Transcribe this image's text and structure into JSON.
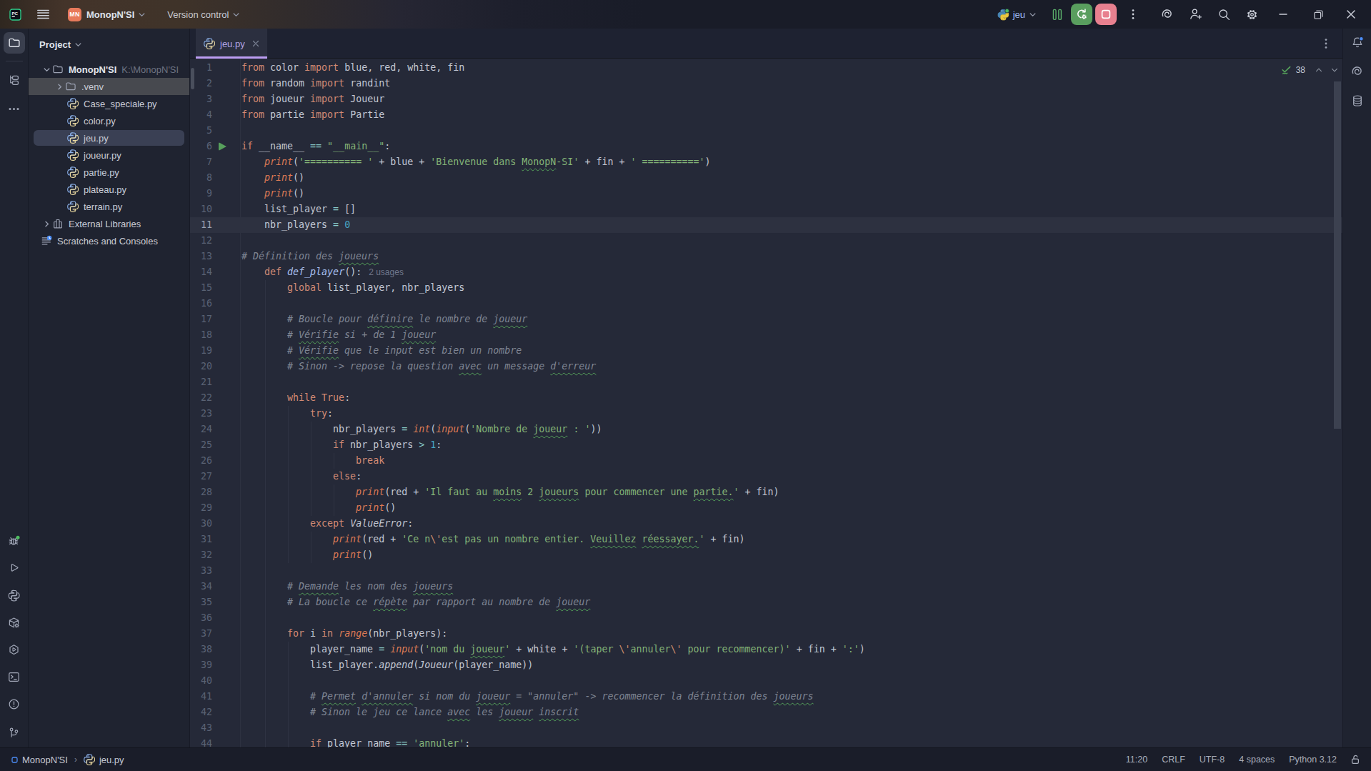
{
  "titlebar": {
    "app": "PyCharm",
    "project_avatar": "MN",
    "project_name": "MonopN'SI",
    "vcs_label": "Version control",
    "run_config": "jeu",
    "accent_green": "#599e5e",
    "accent_red": "#e8808f"
  },
  "tabs": [
    {
      "label": "jeu.py",
      "icon": "python-file",
      "active": true
    }
  ],
  "left_stripe": {
    "top": [
      {
        "name": "project",
        "icon": "folder",
        "selected": true
      },
      {
        "name": "structure",
        "icon": "structure"
      },
      {
        "name": "more-tool-windows",
        "icon": "more-dots"
      }
    ],
    "bottom": [
      {
        "name": "debug",
        "icon": "bug",
        "badge": "green"
      },
      {
        "name": "run",
        "icon": "play"
      },
      {
        "name": "python-console",
        "icon": "python-outline"
      },
      {
        "name": "python-packages",
        "icon": "packages"
      },
      {
        "name": "services",
        "icon": "services"
      },
      {
        "name": "terminal",
        "icon": "terminal"
      },
      {
        "name": "problems",
        "icon": "problems"
      },
      {
        "name": "version-control",
        "icon": "git-branch"
      }
    ]
  },
  "right_stripe": [
    {
      "name": "ai-assistant",
      "icon": "ai-swirl"
    },
    {
      "name": "database",
      "icon": "database"
    }
  ],
  "project_panel": {
    "header": "Project",
    "tree": [
      {
        "label": "MonopN'SI",
        "path": "K:\\MonopN'SI",
        "icon": "folder",
        "chevron": "down",
        "level": 0,
        "bold": true
      },
      {
        "label": ".venv",
        "icon": "folder",
        "chevron": "right",
        "level": 1,
        "hover": true
      },
      {
        "label": "Case_speciale.py",
        "icon": "python-file",
        "level": 2
      },
      {
        "label": "color.py",
        "icon": "python-file",
        "level": 2
      },
      {
        "label": "jeu.py",
        "icon": "python-file",
        "level": 2,
        "selected": true
      },
      {
        "label": "joueur.py",
        "icon": "python-file",
        "level": 2
      },
      {
        "label": "partie.py",
        "icon": "python-file",
        "level": 2
      },
      {
        "label": "plateau.py",
        "icon": "python-file",
        "level": 2
      },
      {
        "label": "terrain.py",
        "icon": "python-file",
        "level": 2
      },
      {
        "label": "External Libraries",
        "icon": "library",
        "chevron": "right",
        "level": 0
      },
      {
        "label": "Scratches and Consoles",
        "icon": "scratches",
        "level": 0
      }
    ]
  },
  "editor": {
    "inspection_count": "38",
    "lines": [
      {
        "n": 1,
        "t": [
          [
            "k",
            "from"
          ],
          [
            "d",
            " color "
          ],
          [
            "k",
            "import"
          ],
          [
            "d",
            " blue, red, white, fin"
          ]
        ]
      },
      {
        "n": 2,
        "t": [
          [
            "k",
            "from"
          ],
          [
            "d",
            " random "
          ],
          [
            "k",
            "import"
          ],
          [
            "d",
            " randint"
          ]
        ]
      },
      {
        "n": 3,
        "t": [
          [
            "k",
            "from"
          ],
          [
            "d",
            " joueur "
          ],
          [
            "k",
            "import"
          ],
          [
            "d",
            " Joueur"
          ]
        ]
      },
      {
        "n": 4,
        "t": [
          [
            "k",
            "from"
          ],
          [
            "d",
            " partie "
          ],
          [
            "k",
            "import"
          ],
          [
            "d",
            " Partie"
          ]
        ]
      },
      {
        "n": 5,
        "t": []
      },
      {
        "n": 6,
        "t": [
          [
            "k",
            "if"
          ],
          [
            "d",
            " __name__ "
          ],
          [
            "o",
            "=="
          ],
          [
            "d",
            " "
          ],
          [
            "s",
            "\"__main__\""
          ],
          [
            "d",
            ":"
          ]
        ],
        "run": true
      },
      {
        "n": 7,
        "t": [
          [
            "d",
            "    "
          ],
          [
            "b",
            "print"
          ],
          [
            "d",
            "("
          ],
          [
            "s",
            "'========== '"
          ],
          [
            "d",
            " + blue + "
          ],
          [
            "s",
            "'Bienvenue dans "
          ],
          [
            "q",
            "MonopN"
          ],
          [
            "s",
            "-SI'"
          ],
          [
            "d",
            " + fin + "
          ],
          [
            "s",
            "' =========='"
          ],
          [
            "d",
            ")"
          ]
        ]
      },
      {
        "n": 8,
        "t": [
          [
            "d",
            "    "
          ],
          [
            "b",
            "print"
          ],
          [
            "d",
            "()"
          ]
        ]
      },
      {
        "n": 9,
        "t": [
          [
            "d",
            "    "
          ],
          [
            "b",
            "print"
          ],
          [
            "d",
            "()"
          ]
        ]
      },
      {
        "n": 10,
        "t": [
          [
            "d",
            "    list_player "
          ],
          [
            "o",
            "="
          ],
          [
            "d",
            " []"
          ]
        ]
      },
      {
        "n": 11,
        "t": [
          [
            "d",
            "    nbr_players "
          ],
          [
            "o",
            "="
          ],
          [
            "d",
            " "
          ],
          [
            "n",
            "0"
          ]
        ],
        "caret": true
      },
      {
        "n": 12,
        "t": []
      },
      {
        "n": 13,
        "t": [
          [
            "c",
            "# Définition des "
          ],
          [
            "m",
            "joueurs"
          ]
        ]
      },
      {
        "n": 14,
        "t": [
          [
            "d",
            "    "
          ],
          [
            "k",
            "def"
          ],
          [
            "d",
            " "
          ],
          [
            "f",
            "def_player"
          ],
          [
            "d",
            "():"
          ],
          [
            "h",
            "2 usages"
          ]
        ]
      },
      {
        "n": 15,
        "t": [
          [
            "d",
            "        "
          ],
          [
            "k",
            "global"
          ],
          [
            "d",
            " list_player, nbr_players"
          ]
        ],
        "g": [
          4
        ]
      },
      {
        "n": 16,
        "t": [],
        "g": [
          4
        ]
      },
      {
        "n": 17,
        "t": [
          [
            "c",
            "        # Boucle pour "
          ],
          [
            "m",
            "définire"
          ],
          [
            "c",
            " le nombre de "
          ],
          [
            "m",
            "joueur"
          ]
        ],
        "g": [
          4
        ]
      },
      {
        "n": 18,
        "t": [
          [
            "c",
            "        # "
          ],
          [
            "m",
            "Vérifie"
          ],
          [
            "c",
            " si + de 1 "
          ],
          [
            "m",
            "joueur"
          ]
        ],
        "g": [
          4
        ]
      },
      {
        "n": 19,
        "t": [
          [
            "c",
            "        # "
          ],
          [
            "m",
            "Vérifie"
          ],
          [
            "c",
            " que le input est bien un nombre"
          ]
        ],
        "g": [
          4
        ]
      },
      {
        "n": 20,
        "t": [
          [
            "c",
            "        # Sinon -> repose la question "
          ],
          [
            "m",
            "avec"
          ],
          [
            "c",
            " un message "
          ],
          [
            "m",
            "d'erreur"
          ]
        ],
        "g": [
          4
        ]
      },
      {
        "n": 21,
        "t": [],
        "g": [
          4
        ]
      },
      {
        "n": 22,
        "t": [
          [
            "d",
            "        "
          ],
          [
            "k",
            "while"
          ],
          [
            "d",
            " "
          ],
          [
            "k",
            "True"
          ],
          [
            "d",
            ":"
          ]
        ],
        "g": [
          4
        ]
      },
      {
        "n": 23,
        "t": [
          [
            "d",
            "            "
          ],
          [
            "k",
            "try"
          ],
          [
            "d",
            ":"
          ]
        ],
        "g": [
          4,
          8
        ]
      },
      {
        "n": 24,
        "t": [
          [
            "d",
            "                nbr_players "
          ],
          [
            "o",
            "="
          ],
          [
            "d",
            " "
          ],
          [
            "b",
            "int"
          ],
          [
            "d",
            "("
          ],
          [
            "b",
            "input"
          ],
          [
            "d",
            "("
          ],
          [
            "s",
            "'Nombre de "
          ],
          [
            "q",
            "joueur"
          ],
          [
            "s",
            " : '"
          ],
          [
            "d",
            "))"
          ]
        ],
        "g": [
          4,
          8,
          12
        ]
      },
      {
        "n": 25,
        "t": [
          [
            "d",
            "                "
          ],
          [
            "k",
            "if"
          ],
          [
            "d",
            " nbr_players "
          ],
          [
            "o",
            ">"
          ],
          [
            "d",
            " "
          ],
          [
            "n",
            "1"
          ],
          [
            "d",
            ":"
          ]
        ],
        "g": [
          4,
          8,
          12
        ]
      },
      {
        "n": 26,
        "t": [
          [
            "d",
            "                    "
          ],
          [
            "k",
            "break"
          ]
        ],
        "g": [
          4,
          8,
          12,
          16
        ]
      },
      {
        "n": 27,
        "t": [
          [
            "d",
            "                "
          ],
          [
            "k",
            "else"
          ],
          [
            "d",
            ":"
          ]
        ],
        "g": [
          4,
          8,
          12
        ]
      },
      {
        "n": 28,
        "t": [
          [
            "d",
            "                    "
          ],
          [
            "b",
            "print"
          ],
          [
            "d",
            "(red + "
          ],
          [
            "s",
            "'Il faut au "
          ],
          [
            "q",
            "moins"
          ],
          [
            "s",
            " 2 "
          ],
          [
            "q",
            "joueurs"
          ],
          [
            "s",
            " pour commencer une "
          ],
          [
            "q",
            "partie."
          ],
          [
            "s",
            "'"
          ],
          [
            "d",
            " + fin)"
          ]
        ],
        "g": [
          4,
          8,
          12,
          16
        ]
      },
      {
        "n": 29,
        "t": [
          [
            "d",
            "                    "
          ],
          [
            "b",
            "print"
          ],
          [
            "d",
            "()"
          ]
        ],
        "g": [
          4,
          8,
          12,
          16
        ]
      },
      {
        "n": 30,
        "t": [
          [
            "d",
            "            "
          ],
          [
            "k",
            "except"
          ],
          [
            "d",
            " "
          ],
          [
            "i",
            "ValueError"
          ],
          [
            "d",
            ":"
          ]
        ],
        "g": [
          4,
          8
        ]
      },
      {
        "n": 31,
        "t": [
          [
            "d",
            "                "
          ],
          [
            "b",
            "print"
          ],
          [
            "d",
            "(red + "
          ],
          [
            "s",
            "'Ce n"
          ],
          [
            "e",
            "\\'"
          ],
          [
            "s",
            "est pas un nombre entier. "
          ],
          [
            "q",
            "Veuillez"
          ],
          [
            "s",
            " "
          ],
          [
            "q",
            "réessayer."
          ],
          [
            "s",
            "'"
          ],
          [
            "d",
            " + fin)"
          ]
        ],
        "g": [
          4,
          8,
          12
        ]
      },
      {
        "n": 32,
        "t": [
          [
            "d",
            "                "
          ],
          [
            "b",
            "print"
          ],
          [
            "d",
            "()"
          ]
        ],
        "g": [
          4,
          8,
          12
        ]
      },
      {
        "n": 33,
        "t": [],
        "g": [
          4
        ]
      },
      {
        "n": 34,
        "t": [
          [
            "c",
            "        # "
          ],
          [
            "m",
            "Demande"
          ],
          [
            "c",
            " les nom des "
          ],
          [
            "m",
            "joueurs"
          ]
        ],
        "g": [
          4
        ]
      },
      {
        "n": 35,
        "t": [
          [
            "c",
            "        # La boucle ce "
          ],
          [
            "m",
            "répète"
          ],
          [
            "c",
            " par rapport au nombre de "
          ],
          [
            "m",
            "joueur"
          ]
        ],
        "g": [
          4
        ]
      },
      {
        "n": 36,
        "t": [],
        "g": [
          4
        ]
      },
      {
        "n": 37,
        "t": [
          [
            "d",
            "        "
          ],
          [
            "k",
            "for"
          ],
          [
            "d",
            " i "
          ],
          [
            "k",
            "in"
          ],
          [
            "d",
            " "
          ],
          [
            "b",
            "range"
          ],
          [
            "d",
            "(nbr_players):"
          ]
        ],
        "g": [
          4
        ]
      },
      {
        "n": 38,
        "t": [
          [
            "d",
            "            player_name "
          ],
          [
            "o",
            "="
          ],
          [
            "d",
            " "
          ],
          [
            "b",
            "input"
          ],
          [
            "d",
            "("
          ],
          [
            "s",
            "'nom du "
          ],
          [
            "q",
            "joueur"
          ],
          [
            "s",
            "'"
          ],
          [
            "d",
            " + white + "
          ],
          [
            "s",
            "'(taper "
          ],
          [
            "e",
            "\\'"
          ],
          [
            "s",
            "annuler"
          ],
          [
            "e",
            "\\'"
          ],
          [
            "s",
            " pour recommencer)'"
          ],
          [
            "d",
            " + fin + "
          ],
          [
            "s",
            "':'"
          ],
          [
            "d",
            ")"
          ]
        ],
        "g": [
          4,
          8
        ]
      },
      {
        "n": 39,
        "t": [
          [
            "d",
            "            list_player."
          ],
          [
            "i",
            "append"
          ],
          [
            "d",
            "("
          ],
          [
            "i",
            "Joueur"
          ],
          [
            "d",
            "(player_name))"
          ]
        ],
        "g": [
          4,
          8
        ]
      },
      {
        "n": 40,
        "t": [],
        "g": [
          4,
          8
        ]
      },
      {
        "n": 41,
        "t": [
          [
            "c",
            "            # "
          ],
          [
            "m",
            "Permet"
          ],
          [
            "c",
            " "
          ],
          [
            "m",
            "d'annuler"
          ],
          [
            "c",
            " si nom du "
          ],
          [
            "m",
            "joueur"
          ],
          [
            "c",
            " = \"annuler\" -> recommencer la définition des "
          ],
          [
            "m",
            "joueurs"
          ]
        ],
        "g": [
          4,
          8
        ]
      },
      {
        "n": 42,
        "t": [
          [
            "c",
            "            # Sinon le jeu ce lance "
          ],
          [
            "m",
            "avec"
          ],
          [
            "c",
            " les "
          ],
          [
            "m",
            "joueur"
          ],
          [
            "c",
            " "
          ],
          [
            "m",
            "inscrit"
          ]
        ],
        "g": [
          4,
          8
        ]
      },
      {
        "n": 43,
        "t": [],
        "g": [
          4,
          8
        ]
      },
      {
        "n": 44,
        "t": [
          [
            "d",
            "            "
          ],
          [
            "k",
            "if"
          ],
          [
            "d",
            " player_name "
          ],
          [
            "o",
            "=="
          ],
          [
            "d",
            " "
          ],
          [
            "s",
            "'annuler'"
          ],
          [
            "d",
            ":"
          ]
        ],
        "g": [
          4,
          8
        ]
      }
    ]
  },
  "statusbar": {
    "breadcrumb_project": "MonopN'SI",
    "breadcrumb_file": "jeu.py",
    "items": [
      "11:20",
      "CRLF",
      "UTF-8",
      "4 spaces",
      "Python 3.12"
    ],
    "lock_icon": "unlocked"
  }
}
